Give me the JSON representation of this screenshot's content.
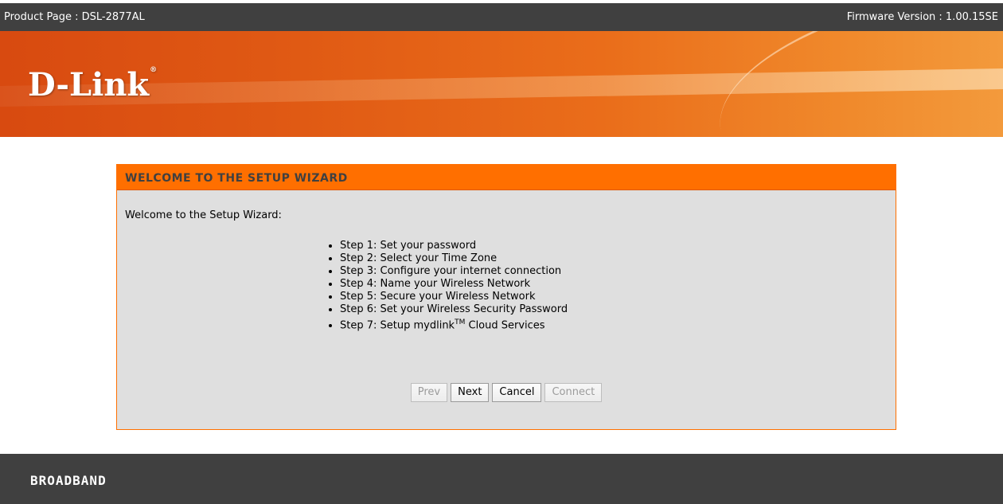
{
  "topbar": {
    "product": "Product Page : DSL-2877AL",
    "firmware": "Firmware Version : 1.00.15SE"
  },
  "banner": {
    "logo_text": "D-Link",
    "logo_mark": "®"
  },
  "wizard": {
    "title": "WELCOME TO THE SETUP WIZARD",
    "intro": "Welcome to the Setup Wizard:",
    "steps": [
      "Step 1: Set your password",
      "Step 2: Select your Time Zone",
      "Step 3: Configure your internet connection",
      "Step 4: Name your Wireless Network",
      "Step 5: Secure your Wireless Network",
      "Step 6: Set your Wireless Security Password",
      "Step 7: Setup mydlink"
    ],
    "step7_tm": "TM",
    "step7_suffix": " Cloud Services",
    "buttons": {
      "prev": "Prev",
      "next": "Next",
      "cancel": "Cancel",
      "connect": "Connect"
    }
  },
  "footer": {
    "label": "BROADBAND"
  },
  "colors": {
    "accent": "#ff6f00",
    "bar": "#404040",
    "panel": "#dfdfdf"
  }
}
